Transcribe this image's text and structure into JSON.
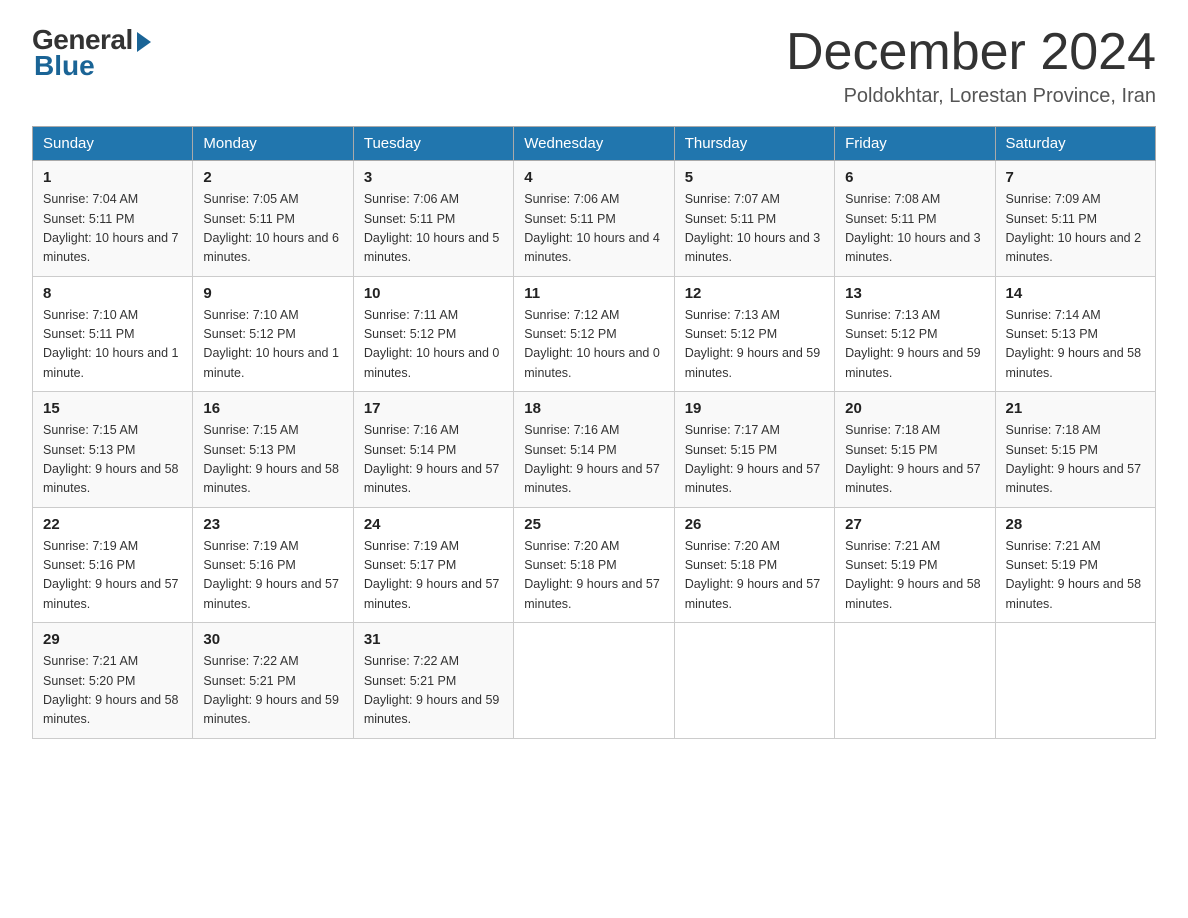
{
  "header": {
    "logo_general": "General",
    "logo_blue": "Blue",
    "month_title": "December 2024",
    "location": "Poldokhtar, Lorestan Province, Iran"
  },
  "days_of_week": [
    "Sunday",
    "Monday",
    "Tuesday",
    "Wednesday",
    "Thursday",
    "Friday",
    "Saturday"
  ],
  "weeks": [
    [
      {
        "day": "1",
        "sunrise": "7:04 AM",
        "sunset": "5:11 PM",
        "daylight": "10 hours and 7 minutes."
      },
      {
        "day": "2",
        "sunrise": "7:05 AM",
        "sunset": "5:11 PM",
        "daylight": "10 hours and 6 minutes."
      },
      {
        "day": "3",
        "sunrise": "7:06 AM",
        "sunset": "5:11 PM",
        "daylight": "10 hours and 5 minutes."
      },
      {
        "day": "4",
        "sunrise": "7:06 AM",
        "sunset": "5:11 PM",
        "daylight": "10 hours and 4 minutes."
      },
      {
        "day": "5",
        "sunrise": "7:07 AM",
        "sunset": "5:11 PM",
        "daylight": "10 hours and 3 minutes."
      },
      {
        "day": "6",
        "sunrise": "7:08 AM",
        "sunset": "5:11 PM",
        "daylight": "10 hours and 3 minutes."
      },
      {
        "day": "7",
        "sunrise": "7:09 AM",
        "sunset": "5:11 PM",
        "daylight": "10 hours and 2 minutes."
      }
    ],
    [
      {
        "day": "8",
        "sunrise": "7:10 AM",
        "sunset": "5:11 PM",
        "daylight": "10 hours and 1 minute."
      },
      {
        "day": "9",
        "sunrise": "7:10 AM",
        "sunset": "5:12 PM",
        "daylight": "10 hours and 1 minute."
      },
      {
        "day": "10",
        "sunrise": "7:11 AM",
        "sunset": "5:12 PM",
        "daylight": "10 hours and 0 minutes."
      },
      {
        "day": "11",
        "sunrise": "7:12 AM",
        "sunset": "5:12 PM",
        "daylight": "10 hours and 0 minutes."
      },
      {
        "day": "12",
        "sunrise": "7:13 AM",
        "sunset": "5:12 PM",
        "daylight": "9 hours and 59 minutes."
      },
      {
        "day": "13",
        "sunrise": "7:13 AM",
        "sunset": "5:12 PM",
        "daylight": "9 hours and 59 minutes."
      },
      {
        "day": "14",
        "sunrise": "7:14 AM",
        "sunset": "5:13 PM",
        "daylight": "9 hours and 58 minutes."
      }
    ],
    [
      {
        "day": "15",
        "sunrise": "7:15 AM",
        "sunset": "5:13 PM",
        "daylight": "9 hours and 58 minutes."
      },
      {
        "day": "16",
        "sunrise": "7:15 AM",
        "sunset": "5:13 PM",
        "daylight": "9 hours and 58 minutes."
      },
      {
        "day": "17",
        "sunrise": "7:16 AM",
        "sunset": "5:14 PM",
        "daylight": "9 hours and 57 minutes."
      },
      {
        "day": "18",
        "sunrise": "7:16 AM",
        "sunset": "5:14 PM",
        "daylight": "9 hours and 57 minutes."
      },
      {
        "day": "19",
        "sunrise": "7:17 AM",
        "sunset": "5:15 PM",
        "daylight": "9 hours and 57 minutes."
      },
      {
        "day": "20",
        "sunrise": "7:18 AM",
        "sunset": "5:15 PM",
        "daylight": "9 hours and 57 minutes."
      },
      {
        "day": "21",
        "sunrise": "7:18 AM",
        "sunset": "5:15 PM",
        "daylight": "9 hours and 57 minutes."
      }
    ],
    [
      {
        "day": "22",
        "sunrise": "7:19 AM",
        "sunset": "5:16 PM",
        "daylight": "9 hours and 57 minutes."
      },
      {
        "day": "23",
        "sunrise": "7:19 AM",
        "sunset": "5:16 PM",
        "daylight": "9 hours and 57 minutes."
      },
      {
        "day": "24",
        "sunrise": "7:19 AM",
        "sunset": "5:17 PM",
        "daylight": "9 hours and 57 minutes."
      },
      {
        "day": "25",
        "sunrise": "7:20 AM",
        "sunset": "5:18 PM",
        "daylight": "9 hours and 57 minutes."
      },
      {
        "day": "26",
        "sunrise": "7:20 AM",
        "sunset": "5:18 PM",
        "daylight": "9 hours and 57 minutes."
      },
      {
        "day": "27",
        "sunrise": "7:21 AM",
        "sunset": "5:19 PM",
        "daylight": "9 hours and 58 minutes."
      },
      {
        "day": "28",
        "sunrise": "7:21 AM",
        "sunset": "5:19 PM",
        "daylight": "9 hours and 58 minutes."
      }
    ],
    [
      {
        "day": "29",
        "sunrise": "7:21 AM",
        "sunset": "5:20 PM",
        "daylight": "9 hours and 58 minutes."
      },
      {
        "day": "30",
        "sunrise": "7:22 AM",
        "sunset": "5:21 PM",
        "daylight": "9 hours and 59 minutes."
      },
      {
        "day": "31",
        "sunrise": "7:22 AM",
        "sunset": "5:21 PM",
        "daylight": "9 hours and 59 minutes."
      },
      null,
      null,
      null,
      null
    ]
  ]
}
